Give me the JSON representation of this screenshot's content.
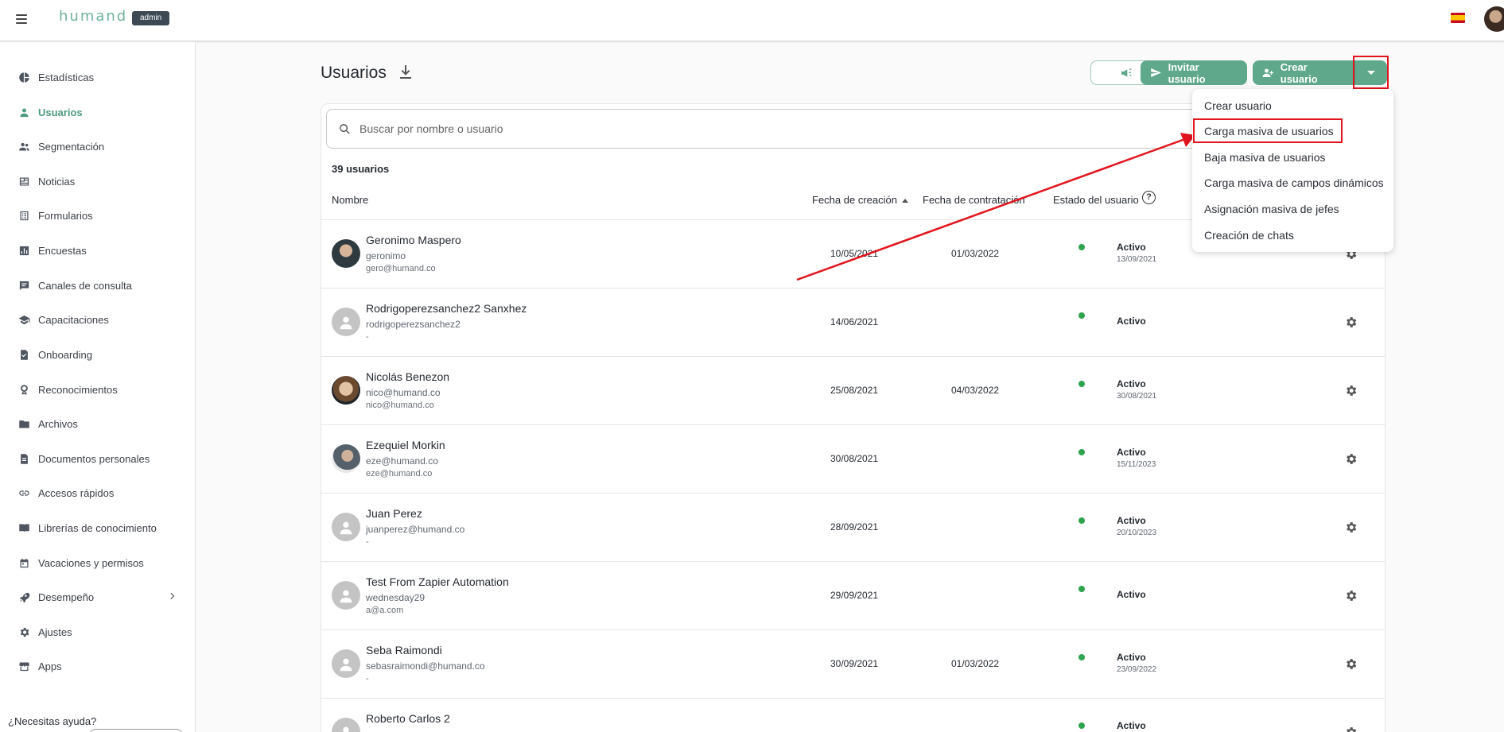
{
  "app": {
    "logo": "humand",
    "badge": "admin"
  },
  "sidebar": {
    "items": [
      {
        "label": "Estadísticas",
        "icon": "pie-chart-icon"
      },
      {
        "label": "Usuarios",
        "icon": "person-icon",
        "active": true
      },
      {
        "label": "Segmentación",
        "icon": "group-icon"
      },
      {
        "label": "Noticias",
        "icon": "newspaper-icon"
      },
      {
        "label": "Formularios",
        "icon": "form-icon"
      },
      {
        "label": "Encuestas",
        "icon": "bar-chart-icon"
      },
      {
        "label": "Canales de consulta",
        "icon": "chat-icon"
      },
      {
        "label": "Capacitaciones",
        "icon": "graduation-cap-icon"
      },
      {
        "label": "Onboarding",
        "icon": "checklist-icon"
      },
      {
        "label": "Reconocimientos",
        "icon": "award-icon"
      },
      {
        "label": "Archivos",
        "icon": "folder-icon"
      },
      {
        "label": "Documentos personales",
        "icon": "document-icon"
      },
      {
        "label": "Accesos rápidos",
        "icon": "link-icon"
      },
      {
        "label": "Librerías de conocimiento",
        "icon": "book-icon"
      },
      {
        "label": "Vacaciones y permisos",
        "icon": "calendar-icon"
      },
      {
        "label": "Desempeño",
        "icon": "rocket-icon",
        "expandable": true
      },
      {
        "label": "Ajustes",
        "icon": "gear-icon"
      },
      {
        "label": "Apps",
        "icon": "store-icon"
      }
    ],
    "help": "¿Necesitas ayuda?"
  },
  "header": {
    "title": "Usuarios",
    "invite_label": "Invitar usuario",
    "create_label": "Crear usuario"
  },
  "dropdown": {
    "items": [
      "Crear usuario",
      "Carga masiva de usuarios",
      "Baja masiva de usuarios",
      "Carga masiva de campos dinámicos",
      "Asignación masiva de jefes",
      "Creación de chats"
    ]
  },
  "search": {
    "placeholder": "Buscar por nombre o usuario"
  },
  "table": {
    "count": "39 usuarios",
    "columns": {
      "name": "Nombre",
      "created": "Fecha de creación",
      "hired": "Fecha de contratación",
      "status": "Estado del usuario"
    },
    "rows": [
      {
        "name": "Geronimo Maspero",
        "user": "geronimo",
        "email": "gero@humand.co",
        "created": "10/05/2021",
        "hired": "01/03/2022",
        "status": "Activo",
        "status_date": "13/09/2021"
      },
      {
        "name": "Rodrigoperezsanchez2 Sanxhez",
        "user": "rodrigoperezsanchez2",
        "email": "-",
        "created": "14/06/2021",
        "hired": "",
        "status": "Activo",
        "status_date": ""
      },
      {
        "name": "Nicolás Benezon",
        "user": "nico@humand.co",
        "email": "nico@humand.co",
        "created": "25/08/2021",
        "hired": "04/03/2022",
        "status": "Activo",
        "status_date": "30/08/2021"
      },
      {
        "name": "Ezequiel Morkin",
        "user": "eze@humand.co",
        "email": "eze@humand.co",
        "created": "30/08/2021",
        "hired": "",
        "status": "Activo",
        "status_date": "15/11/2023"
      },
      {
        "name": "Juan Perez",
        "user": "juanperez@humand.co",
        "email": "-",
        "created": "28/09/2021",
        "hired": "",
        "status": "Activo",
        "status_date": "20/10/2023"
      },
      {
        "name": "Test From Zapier Automation",
        "user": "wednesday29",
        "email": "a@a.com",
        "created": "29/09/2021",
        "hired": "",
        "status": "Activo",
        "status_date": ""
      },
      {
        "name": "Seba Raimondi",
        "user": "sebasraimondi@humand.co",
        "email": "-",
        "created": "30/09/2021",
        "hired": "01/03/2022",
        "status": "Activo",
        "status_date": "23/09/2022"
      },
      {
        "name": "Roberto Carlos 2",
        "user": "",
        "email": "",
        "created": "",
        "hired": "",
        "status": "Activo",
        "status_date": ""
      }
    ]
  },
  "colors": {
    "accent": "#5fa88b",
    "active_nav": "#4e9b7e",
    "status_dot": "#2ea44f",
    "annotation": "#e2141d"
  }
}
